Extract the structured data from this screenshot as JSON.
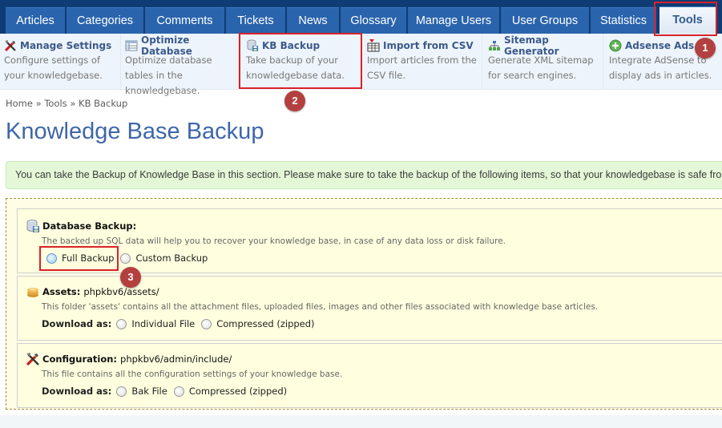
{
  "tabs": [
    {
      "label": "Articles",
      "active": false
    },
    {
      "label": "Categories",
      "active": false
    },
    {
      "label": "Comments",
      "active": false
    },
    {
      "label": "Tickets",
      "active": false
    },
    {
      "label": "News",
      "active": false
    },
    {
      "label": "Glossary",
      "active": false
    },
    {
      "label": "Manage Users",
      "active": false
    },
    {
      "label": "User Groups",
      "active": false
    },
    {
      "label": "Statistics",
      "active": false
    },
    {
      "label": "Tools",
      "active": true
    }
  ],
  "submenu": [
    {
      "icon": "tools-icon",
      "title": "Manage Settings",
      "desc": "Configure settings of your knowledgebase."
    },
    {
      "icon": "database-table-icon",
      "title": "Optimize Database",
      "desc": "Optimize database tables in the knowledgebase."
    },
    {
      "icon": "database-save-icon",
      "title": "KB Backup",
      "desc": "Take backup of your knowledgebase data."
    },
    {
      "icon": "import-csv-icon",
      "title": "Import from CSV",
      "desc": "Import articles from the CSV file."
    },
    {
      "icon": "sitemap-icon",
      "title": "Sitemap Generator",
      "desc": "Generate XML sitemap for search engines."
    },
    {
      "icon": "add-circle-icon",
      "title": "Adsense Ads",
      "desc": "Integrate AdSense to display ads in articles."
    }
  ],
  "breadcrumb": {
    "home": "Home",
    "sep": "»",
    "tools": "Tools",
    "current": "KB Backup"
  },
  "page_title": "Knowledge Base Backup",
  "info_text": "You can take the Backup of Knowledge Base in this section. Please make sure to take the backup of the following items, so that your knowledgebase is safe from",
  "sections": {
    "database": {
      "title": "Database Backup:",
      "desc": "The backed up SQL data will help you to recover your knowledge base, in case of any data loss or disk failure.",
      "options": [
        "Full Backup",
        "Custom Backup"
      ]
    },
    "assets": {
      "title": "Assets:",
      "path": "phpkbv6/assets/",
      "desc": "This folder 'assets' contains all the attachment files, uploaded files, images and other files associated with knowledge base articles.",
      "download_label": "Download as:",
      "options": [
        "Individual File",
        "Compressed (zipped)"
      ]
    },
    "configuration": {
      "title": "Configuration:",
      "path": "phpkbv6/admin/include/",
      "desc": "This file contains all the configuration settings of your knowledge base.",
      "download_label": "Download as:",
      "options": [
        "Bak File",
        "Compressed (zipped)"
      ]
    }
  },
  "annotations": [
    "1",
    "2",
    "3"
  ],
  "colors": {
    "nav_bg": "#0f3c74",
    "tab_bg": "#2a64ac",
    "title_blue": "#3e67a8",
    "highlight_red": "#d9222a",
    "badge_red": "#b3403f",
    "info_green": "#e4f8d8",
    "panel_yellow": "#ffffdf"
  }
}
